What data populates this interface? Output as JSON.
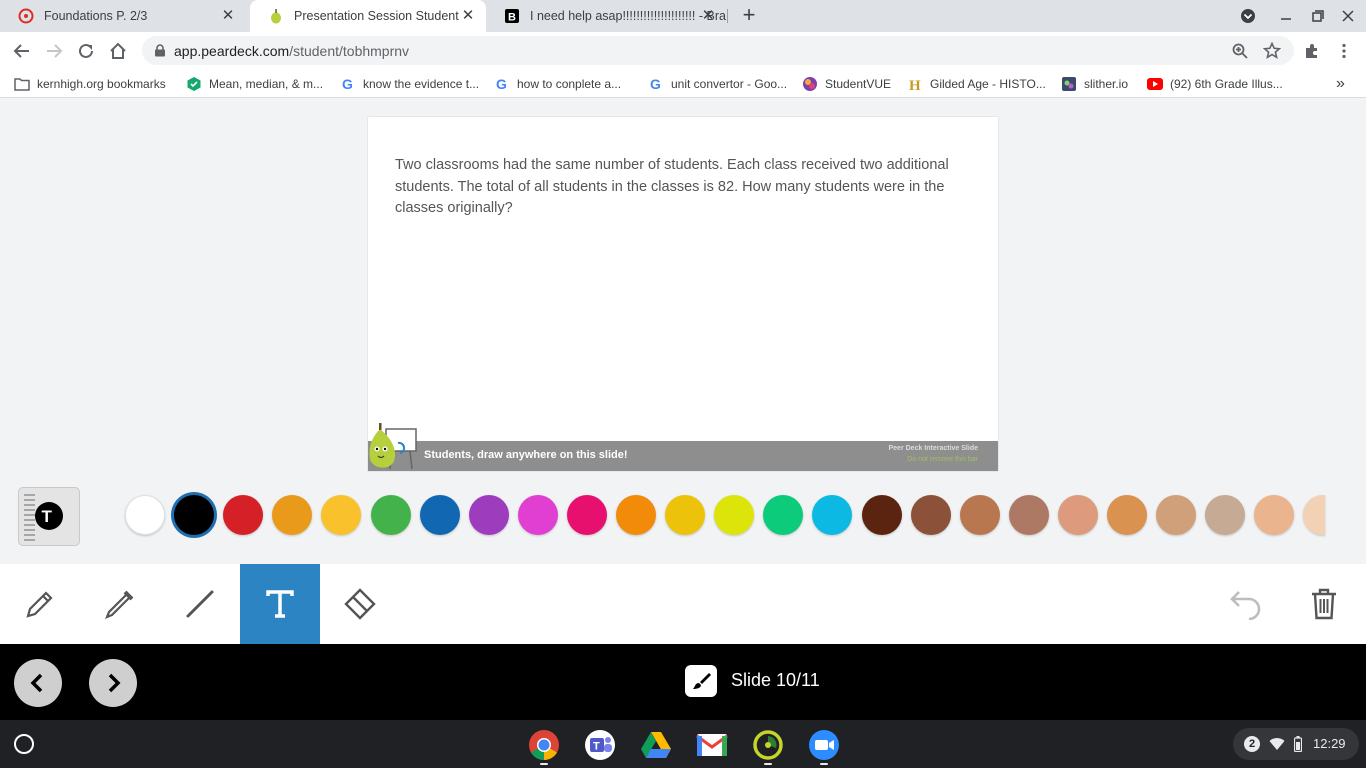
{
  "browser": {
    "tabs": [
      {
        "title": "Foundations P. 2/3",
        "icon": "foundations-favicon"
      },
      {
        "title": "Presentation Session Student",
        "icon": "peardeck-favicon"
      },
      {
        "title": "I need help asap!!!!!!!!!!!!!!!!!!!!! - Bra",
        "icon": "brainly-favicon"
      }
    ],
    "new_tab": "+",
    "url_host": "app.peardeck.com",
    "url_path": "/student/tobhmprnv",
    "bookmarks": [
      {
        "label": "kernhigh.org bookmarks",
        "icon": "folder-icon"
      },
      {
        "label": "Mean, median, & m...",
        "icon": "bookmark-favicon"
      },
      {
        "label": "know the evidence t...",
        "icon": "google-favicon"
      },
      {
        "label": "how to conplete a...",
        "icon": "google-favicon"
      },
      {
        "label": "unit convertor - Goo...",
        "icon": "google-favicon"
      },
      {
        "label": "StudentVUE",
        "icon": "studentvue-favicon"
      },
      {
        "label": "Gilded Age - HISTO...",
        "icon": "history-favicon"
      },
      {
        "label": "slither.io",
        "icon": "slither-favicon"
      },
      {
        "label": "(92) 6th Grade Illus...",
        "icon": "youtube-favicon"
      }
    ],
    "bookmarks_overflow": "»"
  },
  "slide": {
    "question": "Two classrooms had the same number of students. Each class received two additional students. The total of all students in the classes is 82. How many students were in the classes originally?",
    "footer_label": "Students, draw anywhere on this slide!",
    "footer_brand": "Peer Deck Interactive Slide",
    "footer_note": "Do not remove this bar"
  },
  "colors": [
    "#ffffff",
    "#000000",
    "#d62027",
    "#ea9a1b",
    "#f9c22d",
    "#44b24a",
    "#1167b1",
    "#9d3dbd",
    "#e13ed2",
    "#e8106e",
    "#f28a0a",
    "#ecc30a",
    "#dde40a",
    "#0ccb7a",
    "#0cb9e2",
    "#5b2410",
    "#8b5139",
    "#b8774e",
    "#ad7965",
    "#dd9a7d",
    "#d9924f",
    "#cfa07a",
    "#c6aa94",
    "#e9b48e",
    "#f3d1b4"
  ],
  "selected_color": "#000000",
  "tools": [
    {
      "name": "pencil",
      "icon": "pencil-icon"
    },
    {
      "name": "marker",
      "icon": "marker-icon"
    },
    {
      "name": "line",
      "icon": "line-icon"
    },
    {
      "name": "text",
      "icon": "text-tool-icon",
      "active": true
    },
    {
      "name": "eraser",
      "icon": "eraser-icon"
    }
  ],
  "navigation": {
    "slide_label": "Slide 10/11"
  },
  "system": {
    "notifications": "2",
    "time": "12:29"
  }
}
